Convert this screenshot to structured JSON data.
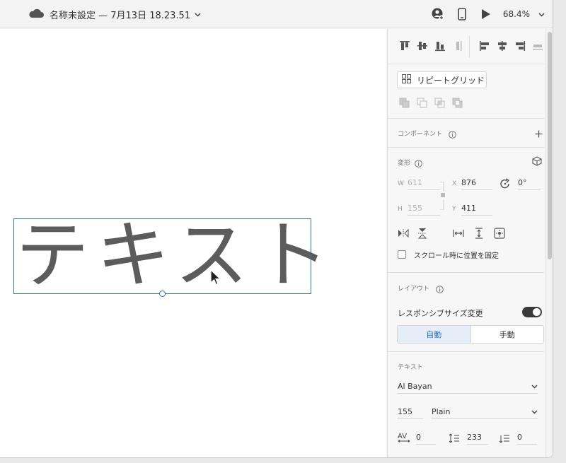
{
  "titlebar": {
    "document_title": "名称未設定 — 7月13日 18.23.51",
    "zoom": "68.4%"
  },
  "canvas": {
    "text_content": "テキスト"
  },
  "panel": {
    "repeat_grid_label": "リピートグリッド",
    "component_section": "コンポーネント",
    "transform_section": "変形",
    "transform": {
      "w_label": "W",
      "w_value": "611",
      "h_label": "H",
      "h_value": "155",
      "x_label": "X",
      "x_value": "876",
      "y_label": "Y",
      "y_value": "411",
      "rotation_value": "0°"
    },
    "fix_scroll_label": "スクロール時に位置を固定",
    "layout_section": "レイアウト",
    "responsive_resize_label": "レスポンシブサイズ変更",
    "resize_mode": {
      "auto": "自動",
      "manual": "手動"
    },
    "text_section": "テキスト",
    "font_family": "Al Bayan",
    "font_size": "155",
    "font_weight": "Plain",
    "char_spacing": "0",
    "line_spacing": "233",
    "paragraph_spacing": "0"
  },
  "colors": {
    "selection": "#2f6fa7",
    "accent": "#2c6bb8"
  }
}
